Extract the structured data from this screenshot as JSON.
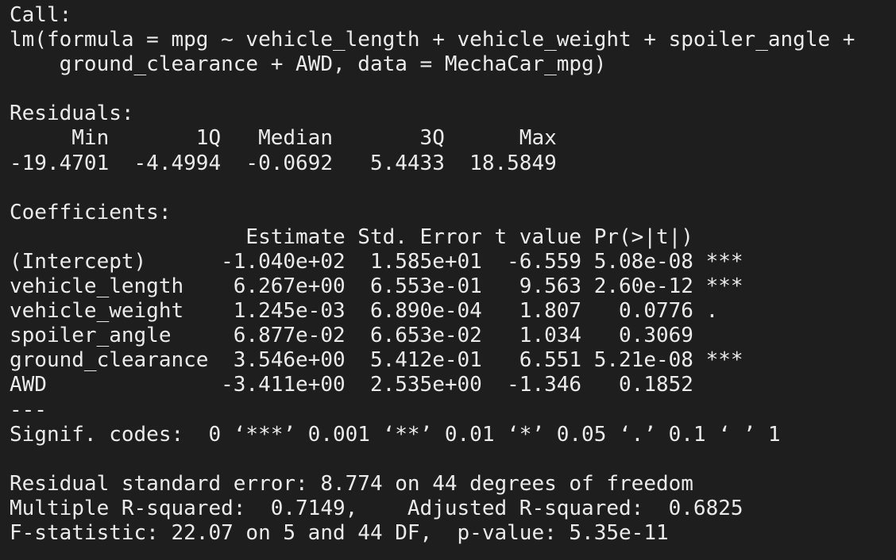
{
  "console": {
    "call_header": "Call:",
    "call_line1": "lm(formula = mpg ~ vehicle_length + vehicle_weight + spoiler_angle +",
    "call_line2": "    ground_clearance + AWD, data = MechaCar_mpg)",
    "residuals_header": "Residuals:",
    "residuals_labels": "     Min       1Q   Median       3Q      Max ",
    "residuals_values": "-19.4701  -4.4994  -0.0692   5.4433  18.5849 ",
    "coefficients_header": "Coefficients:",
    "coef_table_header": "                   Estimate Std. Error t value Pr(>|t|)    ",
    "coef_rows": [
      "(Intercept)      -1.040e+02  1.585e+01  -6.559 5.08e-08 ***",
      "vehicle_length    6.267e+00  6.553e-01   9.563 2.60e-12 ***",
      "vehicle_weight    1.245e-03  6.890e-04   1.807   0.0776 .  ",
      "spoiler_angle     6.877e-02  6.653e-02   1.034   0.3069    ",
      "ground_clearance  3.546e+00  5.412e-01   6.551 5.21e-08 ***",
      "AWD              -3.411e+00  2.535e+00  -1.346   0.1852    "
    ],
    "separator": "---",
    "signif_codes": "Signif. codes:  0 ‘***’ 0.001 ‘**’ 0.01 ‘*’ 0.05 ‘.’ 0.1 ‘ ’ 1",
    "residual_std_error": "Residual standard error: 8.774 on 44 degrees of freedom",
    "r_squared": "Multiple R-squared:  0.7149,\tAdjusted R-squared:  0.6825 ",
    "f_statistic": "F-statistic: 22.07 on 5 and 44 DF,  p-value: 5.35e-11"
  },
  "colors": {
    "background": "#1e1e1e",
    "text": "#ebebeb"
  }
}
